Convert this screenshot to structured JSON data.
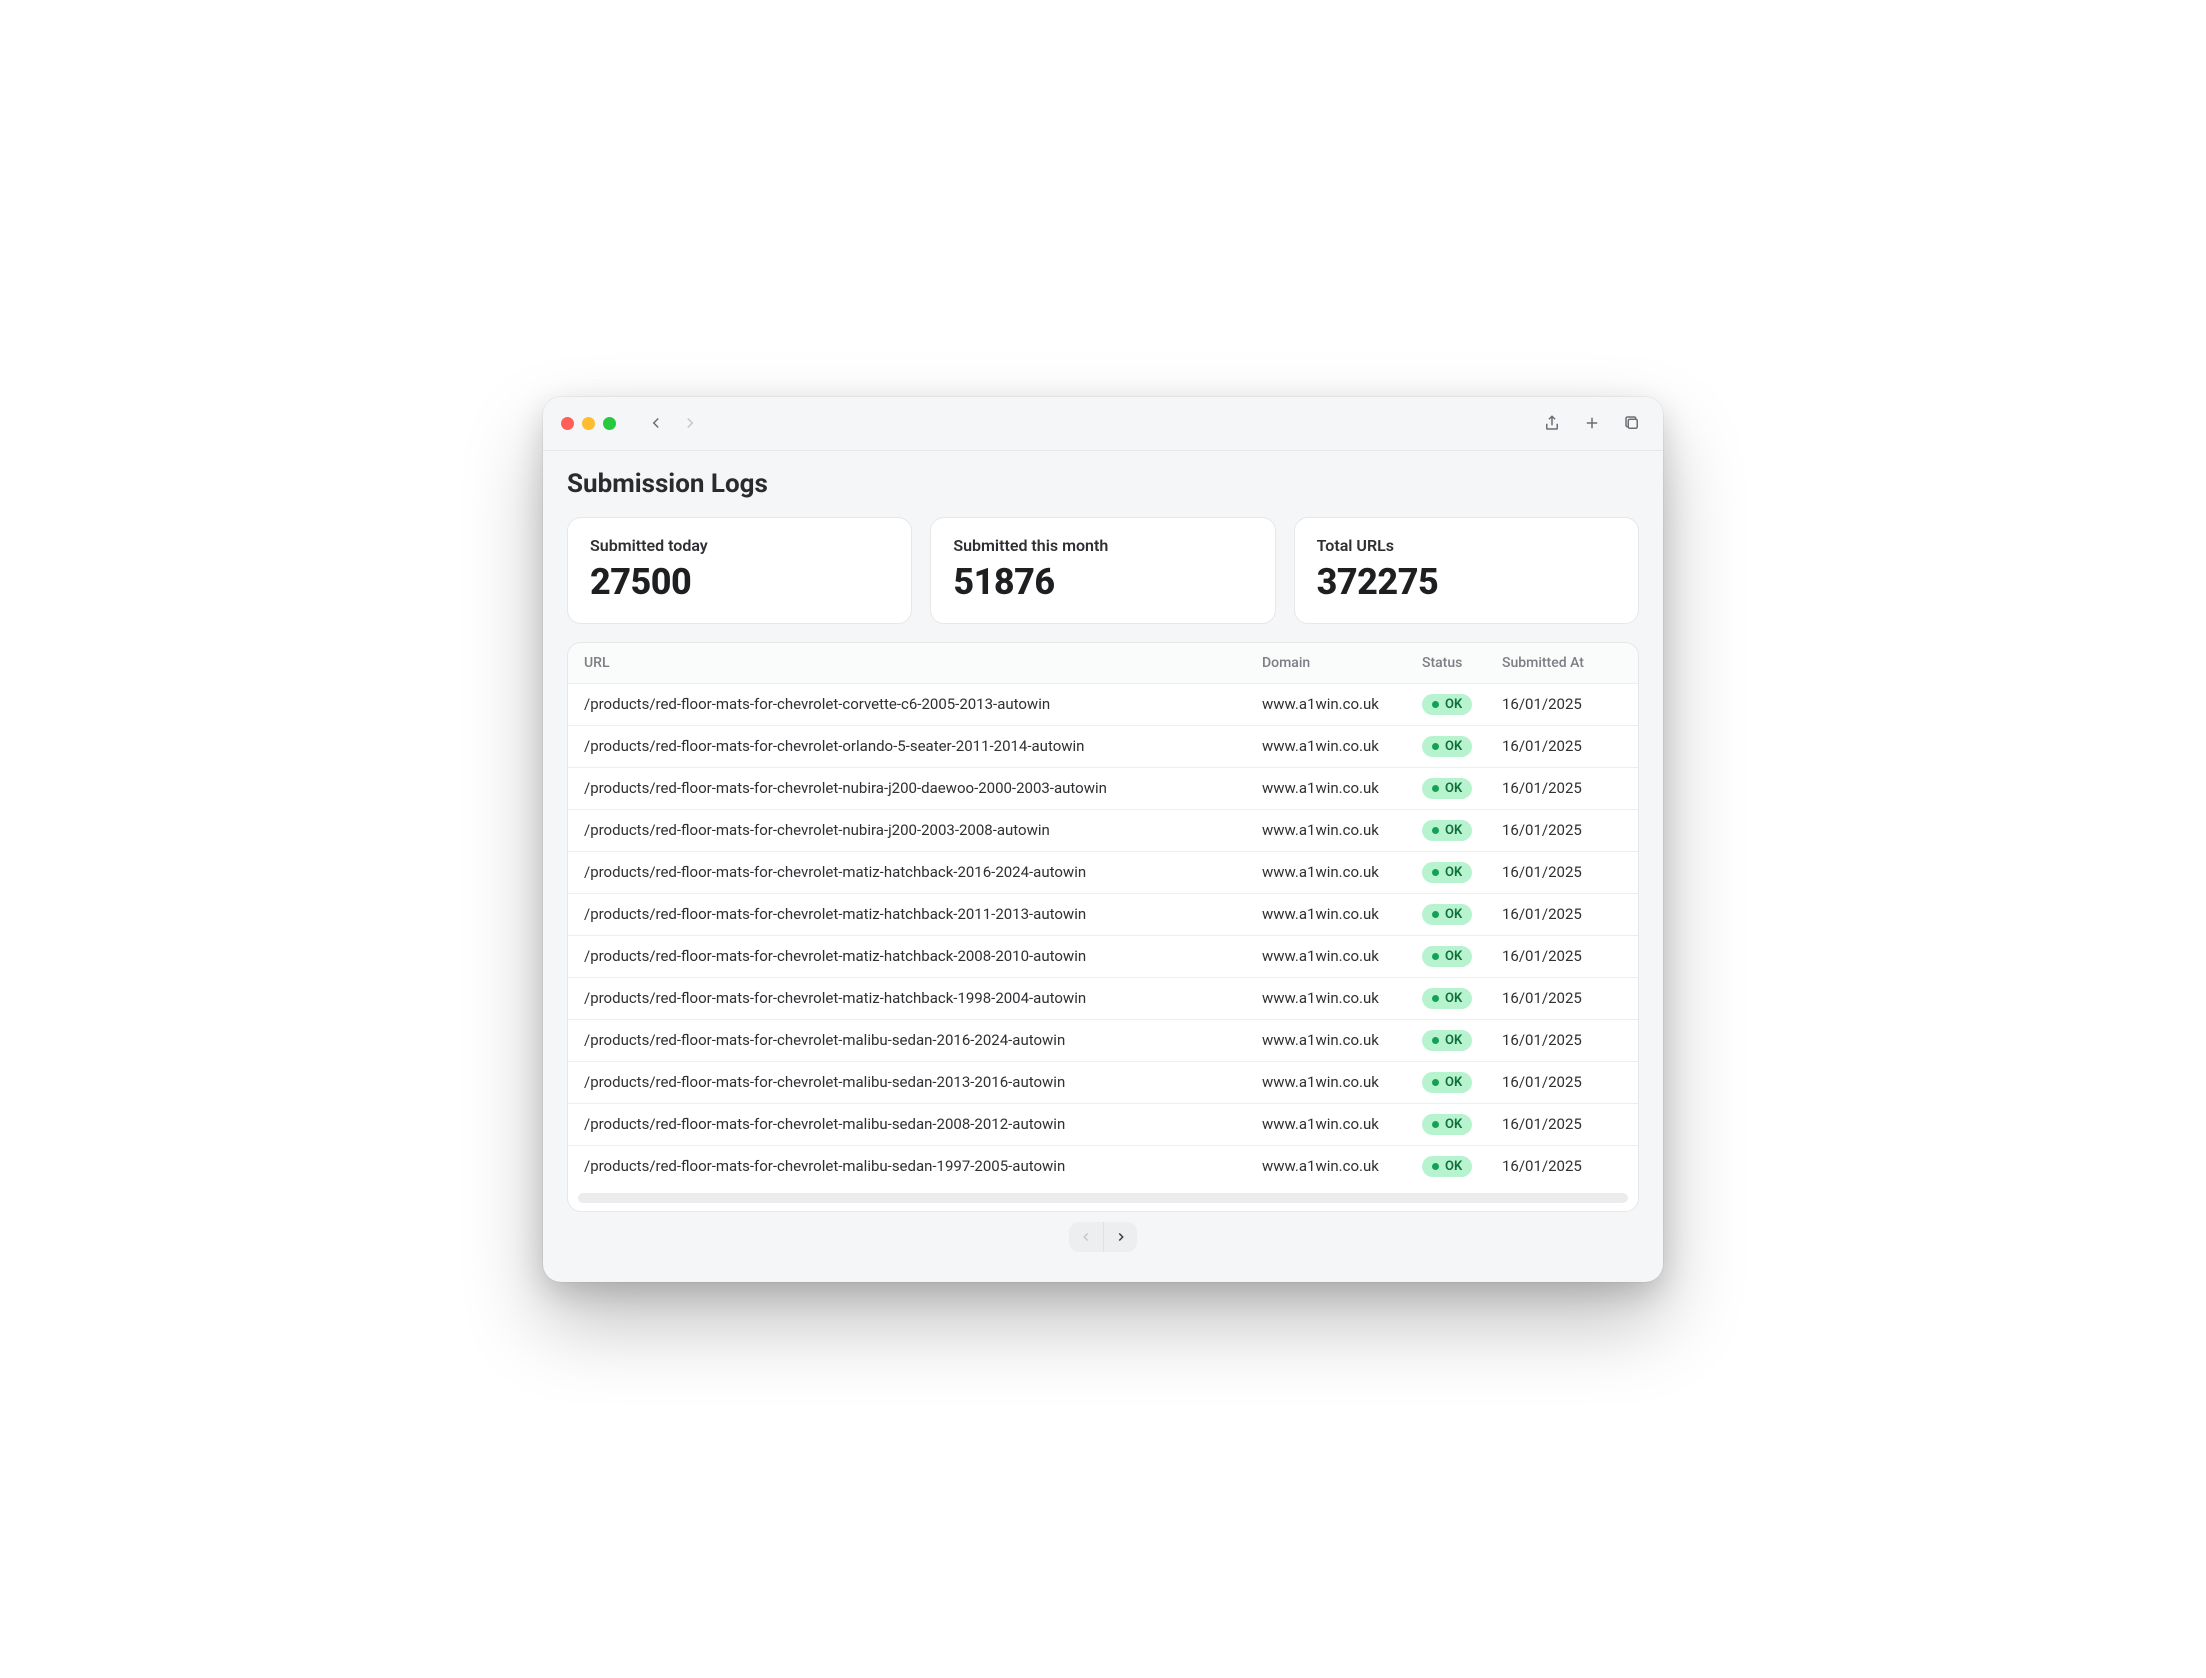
{
  "page": {
    "title": "Submission Logs"
  },
  "stats": [
    {
      "label": "Submitted today",
      "value": "27500"
    },
    {
      "label": "Submitted this month",
      "value": "51876"
    },
    {
      "label": "Total URLs",
      "value": "372275"
    }
  ],
  "table": {
    "headers": {
      "url": "URL",
      "domain": "Domain",
      "status": "Status",
      "submitted_at": "Submitted At"
    },
    "status_ok": "OK",
    "rows": [
      {
        "url": "/products/red-floor-mats-for-chevrolet-corvette-c6-2005-2013-autowin",
        "domain": "www.a1win.co.uk",
        "status": "OK",
        "date": "16/01/2025"
      },
      {
        "url": "/products/red-floor-mats-for-chevrolet-orlando-5-seater-2011-2014-autowin",
        "domain": "www.a1win.co.uk",
        "status": "OK",
        "date": "16/01/2025"
      },
      {
        "url": "/products/red-floor-mats-for-chevrolet-nubira-j200-daewoo-2000-2003-autowin",
        "domain": "www.a1win.co.uk",
        "status": "OK",
        "date": "16/01/2025"
      },
      {
        "url": "/products/red-floor-mats-for-chevrolet-nubira-j200-2003-2008-autowin",
        "domain": "www.a1win.co.uk",
        "status": "OK",
        "date": "16/01/2025"
      },
      {
        "url": "/products/red-floor-mats-for-chevrolet-matiz-hatchback-2016-2024-autowin",
        "domain": "www.a1win.co.uk",
        "status": "OK",
        "date": "16/01/2025"
      },
      {
        "url": "/products/red-floor-mats-for-chevrolet-matiz-hatchback-2011-2013-autowin",
        "domain": "www.a1win.co.uk",
        "status": "OK",
        "date": "16/01/2025"
      },
      {
        "url": "/products/red-floor-mats-for-chevrolet-matiz-hatchback-2008-2010-autowin",
        "domain": "www.a1win.co.uk",
        "status": "OK",
        "date": "16/01/2025"
      },
      {
        "url": "/products/red-floor-mats-for-chevrolet-matiz-hatchback-1998-2004-autowin",
        "domain": "www.a1win.co.uk",
        "status": "OK",
        "date": "16/01/2025"
      },
      {
        "url": "/products/red-floor-mats-for-chevrolet-malibu-sedan-2016-2024-autowin",
        "domain": "www.a1win.co.uk",
        "status": "OK",
        "date": "16/01/2025"
      },
      {
        "url": "/products/red-floor-mats-for-chevrolet-malibu-sedan-2013-2016-autowin",
        "domain": "www.a1win.co.uk",
        "status": "OK",
        "date": "16/01/2025"
      },
      {
        "url": "/products/red-floor-mats-for-chevrolet-malibu-sedan-2008-2012-autowin",
        "domain": "www.a1win.co.uk",
        "status": "OK",
        "date": "16/01/2025"
      },
      {
        "url": "/products/red-floor-mats-for-chevrolet-malibu-sedan-1997-2005-autowin",
        "domain": "www.a1win.co.uk",
        "status": "OK",
        "date": "16/01/2025"
      }
    ]
  }
}
